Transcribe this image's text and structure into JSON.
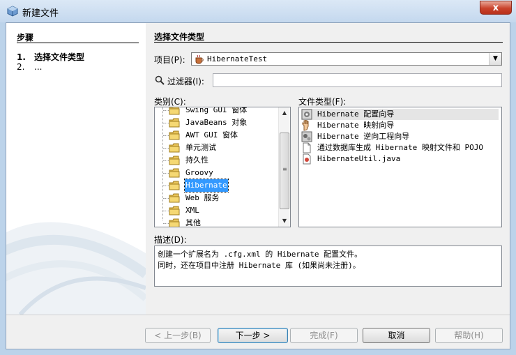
{
  "window": {
    "title": "新建文件",
    "close_label": "x"
  },
  "steps": {
    "title": "步骤",
    "items": [
      {
        "num": "1.",
        "label": "选择文件类型"
      },
      {
        "num": "2.",
        "label": "..."
      }
    ]
  },
  "main": {
    "title": "选择文件类型",
    "project_label": "项目(P):",
    "project_value": "HibernateTest",
    "filter_label": "过滤器(I):",
    "filter_value": "",
    "categories_label": "类别(C):",
    "filetypes_label": "文件类型(F):",
    "description_label": "描述(D):"
  },
  "categories": [
    {
      "label": "Swing GUI 窗体",
      "selected": false
    },
    {
      "label": "JavaBeans 对象",
      "selected": false
    },
    {
      "label": "AWT GUI 窗体",
      "selected": false
    },
    {
      "label": "单元测试",
      "selected": false
    },
    {
      "label": "持久性",
      "selected": false
    },
    {
      "label": "Groovy",
      "selected": false
    },
    {
      "label": "Hibernate",
      "selected": true
    },
    {
      "label": "Web 服务",
      "selected": false
    },
    {
      "label": "XML",
      "selected": false
    },
    {
      "label": "其他",
      "selected": false
    }
  ],
  "file_types": [
    {
      "label": "Hibernate 配置向导",
      "icon": "config-wizard-icon",
      "highlighted": true
    },
    {
      "label": "Hibernate 映射向导",
      "icon": "hand-mapping-icon",
      "highlighted": false
    },
    {
      "label": "Hibernate 逆向工程向导",
      "icon": "reverse-engineering-icon",
      "highlighted": false
    },
    {
      "label": "通过数据库生成 Hibernate 映射文件和 POJO",
      "icon": "blank-file-icon",
      "highlighted": false
    },
    {
      "label": "HibernateUtil.java",
      "icon": "java-file-icon",
      "highlighted": false
    }
  ],
  "description": {
    "line1": "创建一个扩展名为 .cfg.xml 的 Hibernate 配置文件。",
    "line2": "同时，还在项目中注册 Hibernate 库 (如果尚未注册)。"
  },
  "buttons": {
    "back": "< 上一步(B)",
    "next": "下一步 >",
    "finish": "完成(F)",
    "cancel": "取消",
    "help": "帮助(H)"
  },
  "colors": {
    "selection": "#3399ff",
    "window_frame": "#bcd3ea",
    "close_button": "#c9432c"
  }
}
